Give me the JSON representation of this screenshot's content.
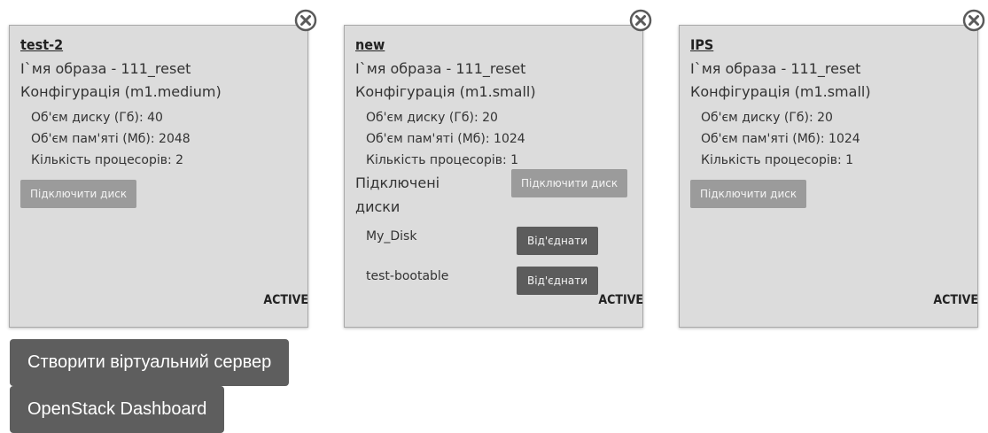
{
  "servers": [
    {
      "name": "test-2",
      "image_line": "І`мя образа - 111_reset",
      "config_line": "Конфігурація (m1.medium)",
      "disk_size": "Об'єм диску (Гб): 40",
      "memory": "Об'єм пам'яті (Мб): 2048",
      "cpus": "Кількість процесорів: 2",
      "attach_disk_label": "Підключити диск",
      "status": "ACTIVE"
    },
    {
      "name": "new",
      "image_line": "І`мя образа - 111_reset",
      "config_line": "Конфігурація (m1.small)",
      "disk_size": "Об'єм диску (Гб): 20",
      "memory": "Об'єм пам'яті (Мб): 1024",
      "cpus": "Кількість процесорів: 1",
      "attach_disk_label": "Підключити диск",
      "attached_title": "Підключені диски",
      "attached_disks": [
        {
          "name": "My_Disk",
          "detach_label": "Від'єднати"
        },
        {
          "name": "test-bootable",
          "detach_label": "Від'єднати"
        }
      ],
      "status": "ACTIVE"
    },
    {
      "name": "IPS",
      "image_line": "І`мя образа - 111_reset",
      "config_line": "Конфігурація (m1.small)",
      "disk_size": "Об'єм диску (Гб): 20",
      "memory": "Об'єм пам'яті (Мб): 1024",
      "cpus": "Кількість процесорів: 1",
      "attach_disk_label": "Підключити диск",
      "status": "ACTIVE"
    }
  ],
  "actions": {
    "create_server_label": "Створити віртуальний сервер",
    "dashboard_label": "OpenStack Dashboard"
  },
  "colors": {
    "card_bg": "#dcdcdc",
    "button_light": "#9b9b9b",
    "button_dark": "#5c5c5c"
  },
  "icons": {
    "remove": "close-circle-icon"
  }
}
